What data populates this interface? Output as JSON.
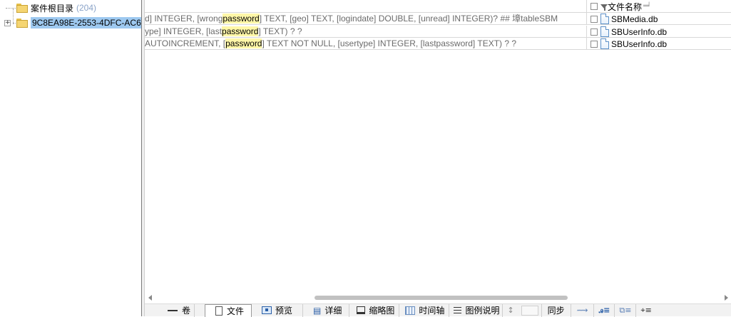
{
  "tree": {
    "root": {
      "label": "案件根目录",
      "count": "(204)"
    },
    "child": {
      "label": "9C8EA98E-2553-4DFC-AC6",
      "expander": "+"
    }
  },
  "grid": {
    "name_header": "文件名称",
    "rows": [
      {
        "pre": "d] INTEGER, [wrong",
        "hl": "password",
        "post": "] TEXT, [geo] TEXT, [logindate] DOUBLE, [unread] INTEGER)?   ## 墇tableSBM",
        "name": "SBMedia.db"
      },
      {
        "pre": "ype] INTEGER, [last",
        "hl": "password",
        "post": "] TEXT)      ? ?",
        "name": "SBUserInfo.db"
      },
      {
        "pre": "AUTOINCREMENT, [",
        "hl": "password",
        "post": "] TEXT NOT NULL, [usertype] INTEGER, [lastpassword] TEXT)      ? ?",
        "name": "SBUserInfo.db"
      }
    ]
  },
  "toolbar": {
    "volume": "卷",
    "file": "文件",
    "preview": "预览",
    "detail": "详细",
    "thumbnail": "缩略图",
    "timeline": "时间轴",
    "legend": "图例说明",
    "sync": "同步"
  },
  "icons": {
    "sort": "sort-indicator-icon",
    "filter": "funnel-icon",
    "file": "document-icon",
    "folder": "folder-icon"
  },
  "colors": {
    "selection": "#9ec9f0",
    "highlight": "#fff7a8",
    "count": "#8aa3c8"
  }
}
